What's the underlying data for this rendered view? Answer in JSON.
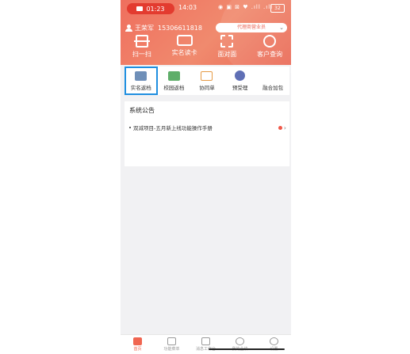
{
  "status_bar": {
    "recording_time": "01:23",
    "clock": "14:03",
    "icons": "◉ ▣ ⊠ ♥ .ıll .ıll",
    "battery": "32"
  },
  "user": {
    "name": "王荣军",
    "phone": "15306611818",
    "role": "代理商营业员"
  },
  "actions": [
    {
      "label": "扫一扫",
      "icon": "scan-icon"
    },
    {
      "label": "实名读卡",
      "icon": "id-card-reader-icon"
    },
    {
      "label": "面对面",
      "icon": "face-to-face-icon"
    },
    {
      "label": "客户查询",
      "icon": "customer-query-icon"
    }
  ],
  "menu": [
    {
      "label": "实名返档",
      "icon": "real-name-return-icon",
      "color": "#6f8fb8",
      "selected": true
    },
    {
      "label": "校园返档",
      "icon": "campus-return-icon",
      "color": "#5fae6a"
    },
    {
      "label": "协同单",
      "icon": "collab-order-icon",
      "color": "#e69a45"
    },
    {
      "label": "预受理",
      "icon": "pre-accept-icon",
      "color": "#5f6fb5"
    },
    {
      "label": "融合加包",
      "icon": "fusion-package-icon",
      "color": "#ffffff"
    }
  ],
  "notice": {
    "title": "系统公告",
    "items": [
      {
        "text": "双减项目-五月新上线功能操作手册"
      }
    ]
  },
  "tabbar": [
    {
      "label": "首页",
      "active": true
    },
    {
      "label": "功能菜单"
    },
    {
      "label": "消息工作台"
    },
    {
      "label": "我的业绩"
    },
    {
      "label": "设置"
    }
  ],
  "colors": {
    "brand": "#ef6f5e",
    "selection": "#1f8fe0"
  }
}
